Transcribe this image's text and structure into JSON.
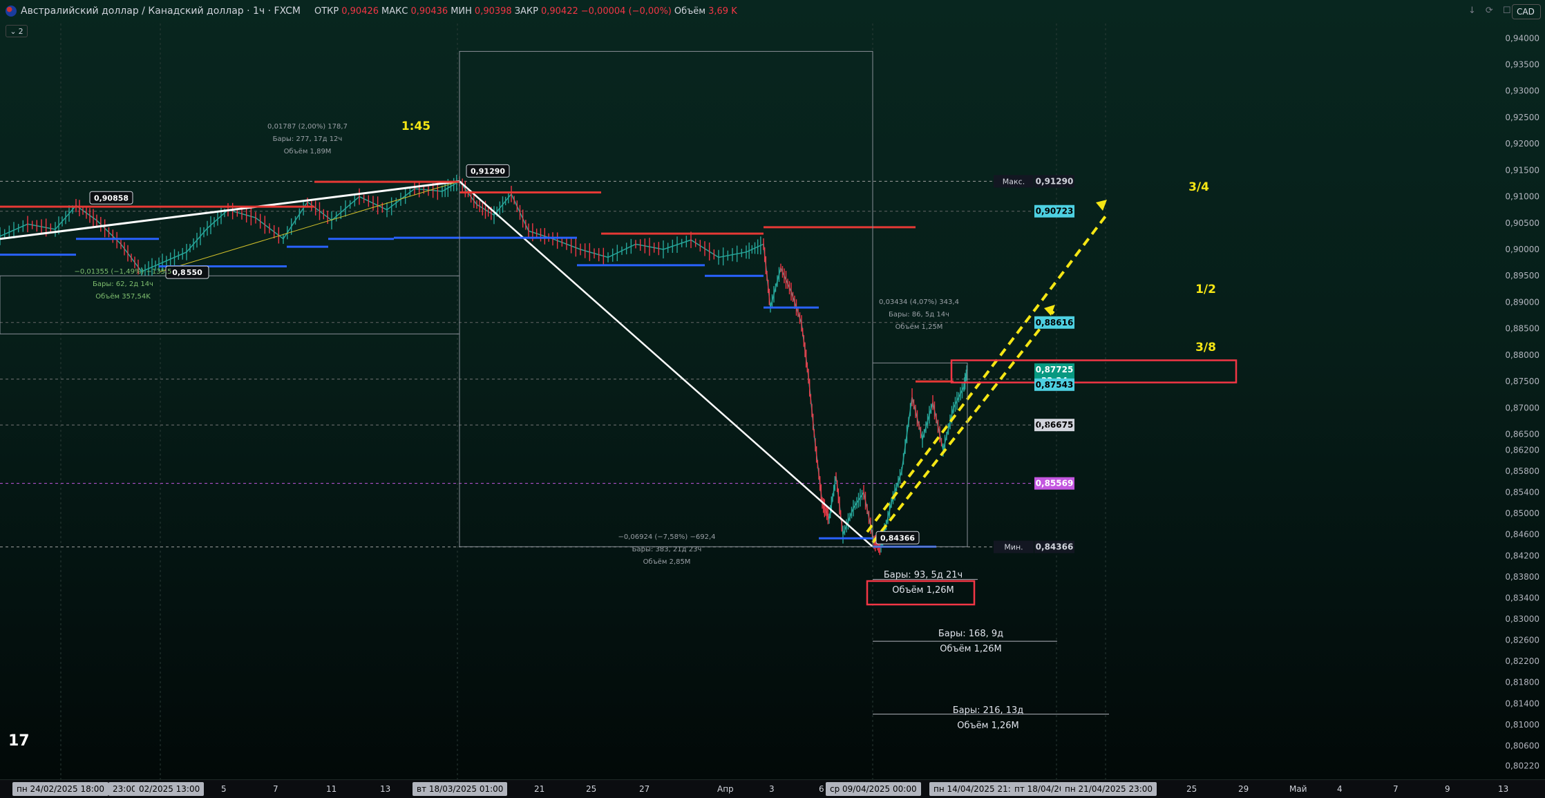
{
  "header": {
    "symbol": "Австралийский доллар / Канадский доллар · 1ч · FXCM",
    "ohlc": [
      {
        "k": "ОТКР",
        "v": "0,90426"
      },
      {
        "k": "МАКС",
        "v": "0,90436"
      },
      {
        "k": "МИН",
        "v": "0,90398"
      },
      {
        "k": "ЗАКР",
        "v": "0,90422"
      },
      {
        "k": "",
        "v": "−0,00004 (−0,00%)"
      },
      {
        "k": "Объём",
        "v": "3,69 K"
      }
    ],
    "currency_button": "CAD",
    "indicators_count": "2"
  },
  "colors": {
    "up": "#26a69a",
    "down": "#f23645",
    "accent_yellow": "#f5e614",
    "red_line": "#e53935",
    "blue_line": "#2962ff"
  },
  "chart_data": {
    "type": "line",
    "title": "",
    "symbol": "AUDCAD",
    "ylim": [
      0.802,
      0.942
    ],
    "y_ticks": [
      "0,94000",
      "0,93500",
      "0,93000",
      "0,92500",
      "0,92000",
      "0,91500",
      "0,91000",
      "0,90500",
      "0,90000",
      "0,89500",
      "0,89000",
      "0,88500",
      "0,88000",
      "0,87500",
      "0,87000",
      "0,86500",
      "0,86200",
      "0,85800",
      "0,85400",
      "0,85000",
      "0,84600",
      "0,84200",
      "0,83800",
      "0,83400",
      "0,83000",
      "0,82600",
      "0,82200",
      "0,81800",
      "0,81400",
      "0,81000",
      "0,80600",
      "0,80220"
    ],
    "price_labels": [
      {
        "tag": "Макс.",
        "value": "0,91290",
        "color": "#d1d4dc",
        "bg": "#131722"
      },
      {
        "tag": "",
        "value": "0,90723",
        "color": "#000",
        "bg": "#4dd0e1"
      },
      {
        "tag": "",
        "value": "0,88616",
        "color": "#000",
        "bg": "#4dd0e1"
      },
      {
        "tag": "",
        "value": "0,87725",
        "color": "#fff",
        "bg": "#089981"
      },
      {
        "tag": "",
        "value": "32:24",
        "color": "#fff",
        "bg": "#089981"
      },
      {
        "tag": "",
        "value": "0,87543",
        "color": "#000",
        "bg": "#4dd0e1"
      },
      {
        "tag": "",
        "value": "0,86675",
        "color": "#000",
        "bg": "#d1d4dc"
      },
      {
        "tag": "",
        "value": "0,85569",
        "color": "#fff",
        "bg": "#c457e0"
      },
      {
        "tag": "Мин.",
        "value": "0,84366",
        "color": "#d1d4dc",
        "bg": "#131722"
      }
    ],
    "x_ticks": [
      "5",
      "7",
      "11",
      "13",
      "21",
      "25",
      "27",
      "Апр",
      "3",
      "6",
      "25",
      "29",
      "Май",
      "4",
      "7",
      "9",
      "13"
    ],
    "x_highlights": [
      "пн 24/02/2025   18:00",
      "23:00",
      "02/2025   13:00",
      "вт 18/03/2025   01:00",
      "ср 09/04/2025   00:00",
      "пн 14/04/2025   21:",
      "пт 18/04/20",
      "пн 21/04/2025   23:00"
    ],
    "price_series": [
      {
        "t": 0,
        "c": 0.9025
      },
      {
        "t": 40,
        "c": 0.9048
      },
      {
        "t": 80,
        "c": 0.9038
      },
      {
        "t": 110,
        "c": 0.9083
      },
      {
        "t": 140,
        "c": 0.9055
      },
      {
        "t": 175,
        "c": 0.901
      },
      {
        "t": 205,
        "c": 0.8958
      },
      {
        "t": 235,
        "c": 0.8975
      },
      {
        "t": 270,
        "c": 0.8995
      },
      {
        "t": 300,
        "c": 0.904
      },
      {
        "t": 330,
        "c": 0.9075
      },
      {
        "t": 370,
        "c": 0.906
      },
      {
        "t": 410,
        "c": 0.902
      },
      {
        "t": 445,
        "c": 0.909
      },
      {
        "t": 480,
        "c": 0.9055
      },
      {
        "t": 520,
        "c": 0.91
      },
      {
        "t": 560,
        "c": 0.9075
      },
      {
        "t": 600,
        "c": 0.9115
      },
      {
        "t": 640,
        "c": 0.911
      },
      {
        "t": 665,
        "c": 0.9129
      },
      {
        "t": 690,
        "c": 0.9085
      },
      {
        "t": 715,
        "c": 0.9065
      },
      {
        "t": 740,
        "c": 0.9105
      },
      {
        "t": 765,
        "c": 0.9035
      },
      {
        "t": 800,
        "c": 0.902
      },
      {
        "t": 840,
        "c": 0.9
      },
      {
        "t": 880,
        "c": 0.8985
      },
      {
        "t": 920,
        "c": 0.901
      },
      {
        "t": 960,
        "c": 0.9
      },
      {
        "t": 1000,
        "c": 0.9018
      },
      {
        "t": 1040,
        "c": 0.8985
      },
      {
        "t": 1080,
        "c": 0.8995
      },
      {
        "t": 1105,
        "c": 0.901
      },
      {
        "t": 1115,
        "c": 0.889
      },
      {
        "t": 1130,
        "c": 0.8965
      },
      {
        "t": 1145,
        "c": 0.892
      },
      {
        "t": 1160,
        "c": 0.886
      },
      {
        "t": 1170,
        "c": 0.876
      },
      {
        "t": 1180,
        "c": 0.863
      },
      {
        "t": 1190,
        "c": 0.852
      },
      {
        "t": 1200,
        "c": 0.849
      },
      {
        "t": 1210,
        "c": 0.857
      },
      {
        "t": 1220,
        "c": 0.846
      },
      {
        "t": 1235,
        "c": 0.851
      },
      {
        "t": 1250,
        "c": 0.854
      },
      {
        "t": 1265,
        "c": 0.8445
      },
      {
        "t": 1275,
        "c": 0.8437
      },
      {
        "t": 1290,
        "c": 0.852
      },
      {
        "t": 1305,
        "c": 0.858
      },
      {
        "t": 1320,
        "c": 0.872
      },
      {
        "t": 1335,
        "c": 0.864
      },
      {
        "t": 1350,
        "c": 0.871
      },
      {
        "t": 1365,
        "c": 0.862
      },
      {
        "t": 1380,
        "c": 0.87
      },
      {
        "t": 1395,
        "c": 0.874
      },
      {
        "t": 1400,
        "c": 0.8772
      }
    ],
    "annotations": [
      {
        "text": "0,90858",
        "x": 0.9086
      },
      {
        "text": "0,91290"
      },
      {
        "text": "0,84366"
      },
      {
        "text": "0,8 550"
      },
      {
        "text": "1:45"
      },
      {
        "text": "3/4"
      },
      {
        "text": "1/2"
      },
      {
        "text": "3/8"
      }
    ],
    "measures": [
      {
        "l1": "0,01787 (2,00%) 178,7",
        "l2": "Бары: 277, 17д 12ч",
        "l3": "Объём 1,89M"
      },
      {
        "l1": "−0,01355 (−1,49%) −135,5",
        "l2": "Бары: 62, 2д 14ч",
        "l3": "Объём 357,54K"
      },
      {
        "l1": "0,03434 (4,07%) 343,4",
        "l2": "Бары: 86, 5д 14ч",
        "l3": "Объём 1,25M"
      },
      {
        "l1": "−0,06924 (−7,58%) −692,4",
        "l2": "Бары: 383, 21д 23ч",
        "l3": "Объём 2,85M"
      },
      {
        "l1": "Бары: 93, 5д 21ч",
        "l2": "Объём 1,26M"
      },
      {
        "l1": "Бары: 168, 9д",
        "l2": "Объём 1,26M"
      },
      {
        "l1": "Бары: 216, 13д",
        "l2": "Объём 1,26M"
      }
    ]
  }
}
